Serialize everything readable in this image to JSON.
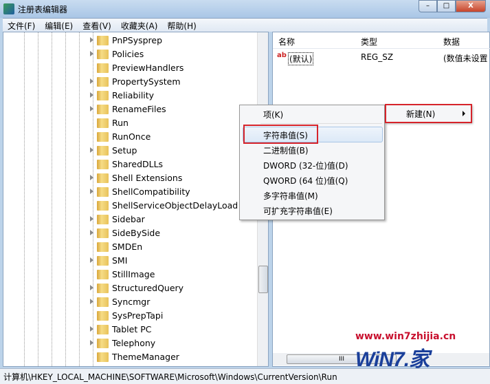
{
  "window": {
    "title": "注册表编辑器",
    "min": "–",
    "max": "□",
    "close": "X"
  },
  "menu": [
    "文件(F)",
    "编辑(E)",
    "查看(V)",
    "收藏夹(A)",
    "帮助(H)"
  ],
  "tree": [
    {
      "label": "PnPSysprep",
      "expandable": true
    },
    {
      "label": "Policies",
      "expandable": true
    },
    {
      "label": "PreviewHandlers",
      "expandable": false
    },
    {
      "label": "PropertySystem",
      "expandable": true
    },
    {
      "label": "Reliability",
      "expandable": true
    },
    {
      "label": "RenameFiles",
      "expandable": true
    },
    {
      "label": "Run",
      "expandable": false,
      "selected": true
    },
    {
      "label": "RunOnce",
      "expandable": false
    },
    {
      "label": "Setup",
      "expandable": true
    },
    {
      "label": "SharedDLLs",
      "expandable": false
    },
    {
      "label": "Shell Extensions",
      "expandable": true
    },
    {
      "label": "ShellCompatibility",
      "expandable": true
    },
    {
      "label": "ShellServiceObjectDelayLoad",
      "expandable": false
    },
    {
      "label": "Sidebar",
      "expandable": true
    },
    {
      "label": "SideBySide",
      "expandable": true
    },
    {
      "label": "SMDEn",
      "expandable": false
    },
    {
      "label": "SMI",
      "expandable": true
    },
    {
      "label": "StillImage",
      "expandable": false
    },
    {
      "label": "StructuredQuery",
      "expandable": true
    },
    {
      "label": "Syncmgr",
      "expandable": true
    },
    {
      "label": "SysPrepTapi",
      "expandable": false
    },
    {
      "label": "Tablet PC",
      "expandable": true
    },
    {
      "label": "Telephony",
      "expandable": true
    },
    {
      "label": "ThemeManager",
      "expandable": false
    }
  ],
  "list": {
    "columns": [
      "名称",
      "类型",
      "数据"
    ],
    "rows": [
      {
        "icon": "ab",
        "name": "(默认)",
        "type": "REG_SZ",
        "data": "(数值未设置"
      }
    ],
    "hscroll_grip": "III"
  },
  "context_menu": {
    "items": [
      "项(K)",
      "字符串值(S)",
      "二进制值(B)",
      "DWORD (32-位)值(D)",
      "QWORD (64 位)值(Q)",
      "多字符串值(M)",
      "可扩充字符串值(E)"
    ],
    "highlighted": "字符串值(S)"
  },
  "submenu": {
    "label": "新建(N)"
  },
  "status": "计算机\\HKEY_LOCAL_MACHINE\\SOFTWARE\\Microsoft\\Windows\\CurrentVersion\\Run",
  "watermark": {
    "url": "www.win7zhijia.cn",
    "logo": "WiN7.",
    "logo_char": "家"
  },
  "colors": {
    "highlight_box": "#d6232a",
    "watermark_url": "#c8102e",
    "watermark_logo": "#1a3f9a"
  }
}
